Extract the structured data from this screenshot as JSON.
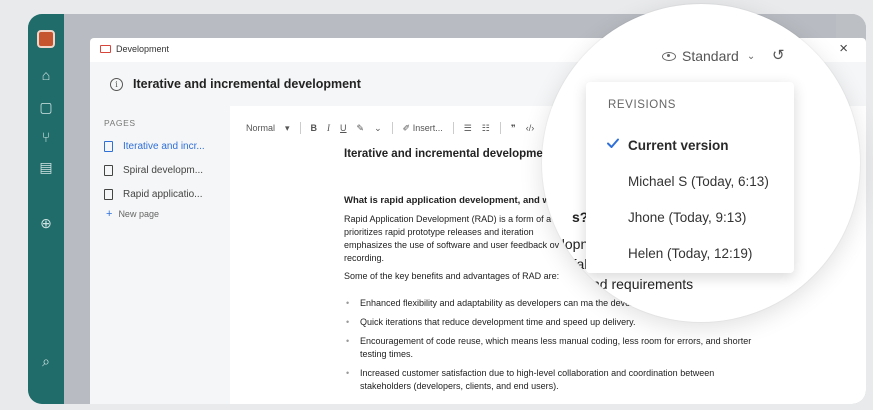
{
  "window": {
    "breadcrumb": "Development",
    "close_label": "×"
  },
  "header": {
    "title": "Iterative and incremental development"
  },
  "sidebar": {
    "heading": "PAGES",
    "items": [
      {
        "label": "Iterative and incr...",
        "active": true
      },
      {
        "label": "Spiral developm...",
        "active": false
      },
      {
        "label": "Rapid applicatio...",
        "active": false
      }
    ],
    "new_page_label": "New page"
  },
  "toolbar": {
    "style_label": "Normal",
    "bold": "B",
    "italic": "I",
    "underline": "U",
    "insert_label": "Insert..."
  },
  "editor": {
    "doc_title": "Iterative and incremental development",
    "subheading": "What is rapid application development, and wha",
    "para1": "Rapid Application Development (RAD) is a form of a that prioritizes rapid prototype releases and iteration emphasizes the use of software and user feedback ov recording.",
    "para2": "Some of the key benefits and advantages of RAD are:",
    "bullets": [
      "Enhanced flexibility and adaptability as developers can ma the development process.",
      "Quick iterations that reduce development time and speed up delivery.",
      "Encouragement of code reuse, which means less manual coding, less room for errors, and shorter testing times.",
      "Increased customer satisfaction due to high-level collaboration and coordination between stakeholders (developers, clients, and end users)."
    ]
  },
  "magnifier": {
    "view_mode": "Standard",
    "bg_fragments": [
      "s?",
      "elopn",
      "rfal",
      "nd requirements"
    ]
  },
  "revisions": {
    "heading": "REVISIONS",
    "items": [
      {
        "label": "Current version",
        "current": true
      },
      {
        "label": "Michael S (Today, 6:13)",
        "current": false
      },
      {
        "label": "Jhone (Today, 9:13)",
        "current": false
      },
      {
        "label": "Helen (Today, 12:19)",
        "current": false
      }
    ]
  },
  "colors": {
    "rail": "#1f6c6a",
    "accent": "#2f6fd8",
    "folder": "#d9443b"
  }
}
